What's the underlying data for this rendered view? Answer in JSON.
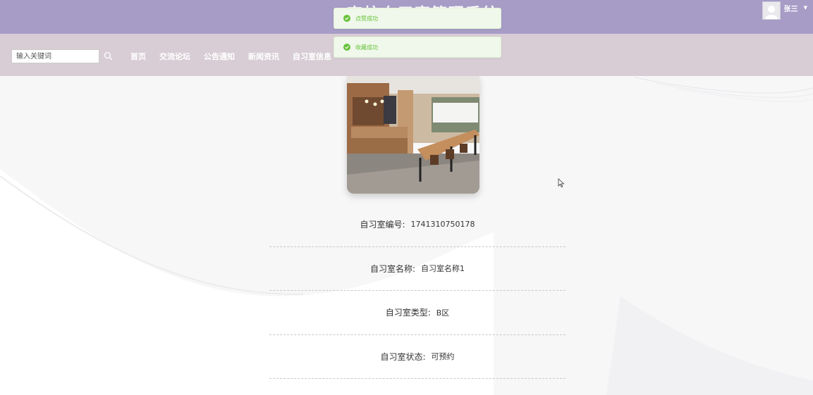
{
  "header": {
    "site_title": "高校自习室管理系统",
    "user_name": "张三"
  },
  "nav": {
    "search_placeholder": "输入关键词",
    "items": [
      "首页",
      "交流论坛",
      "公告通知",
      "新闻资讯",
      "自习室信息"
    ]
  },
  "toasts": [
    {
      "text": "点赞成功",
      "type": "success"
    },
    {
      "text": "收藏成功",
      "type": "success"
    }
  ],
  "detail": {
    "fields": [
      {
        "label": "自习室编号:",
        "value": "1741310750178"
      },
      {
        "label": "自习室名称:",
        "value": "自习室名称1"
      },
      {
        "label": "自习室类型:",
        "value": "B区"
      },
      {
        "label": "自习室状态:",
        "value": "可预约"
      }
    ]
  },
  "colors": {
    "header_bg": "#a69cc6",
    "nav_bg": "#d8cdd4",
    "toast_bg": "#eff8ea",
    "toast_text": "#67c23a"
  },
  "icons": {
    "search": "search-icon",
    "success": "check-circle-icon",
    "avatar": "user-avatar-icon",
    "caret": "caret-down-icon"
  }
}
